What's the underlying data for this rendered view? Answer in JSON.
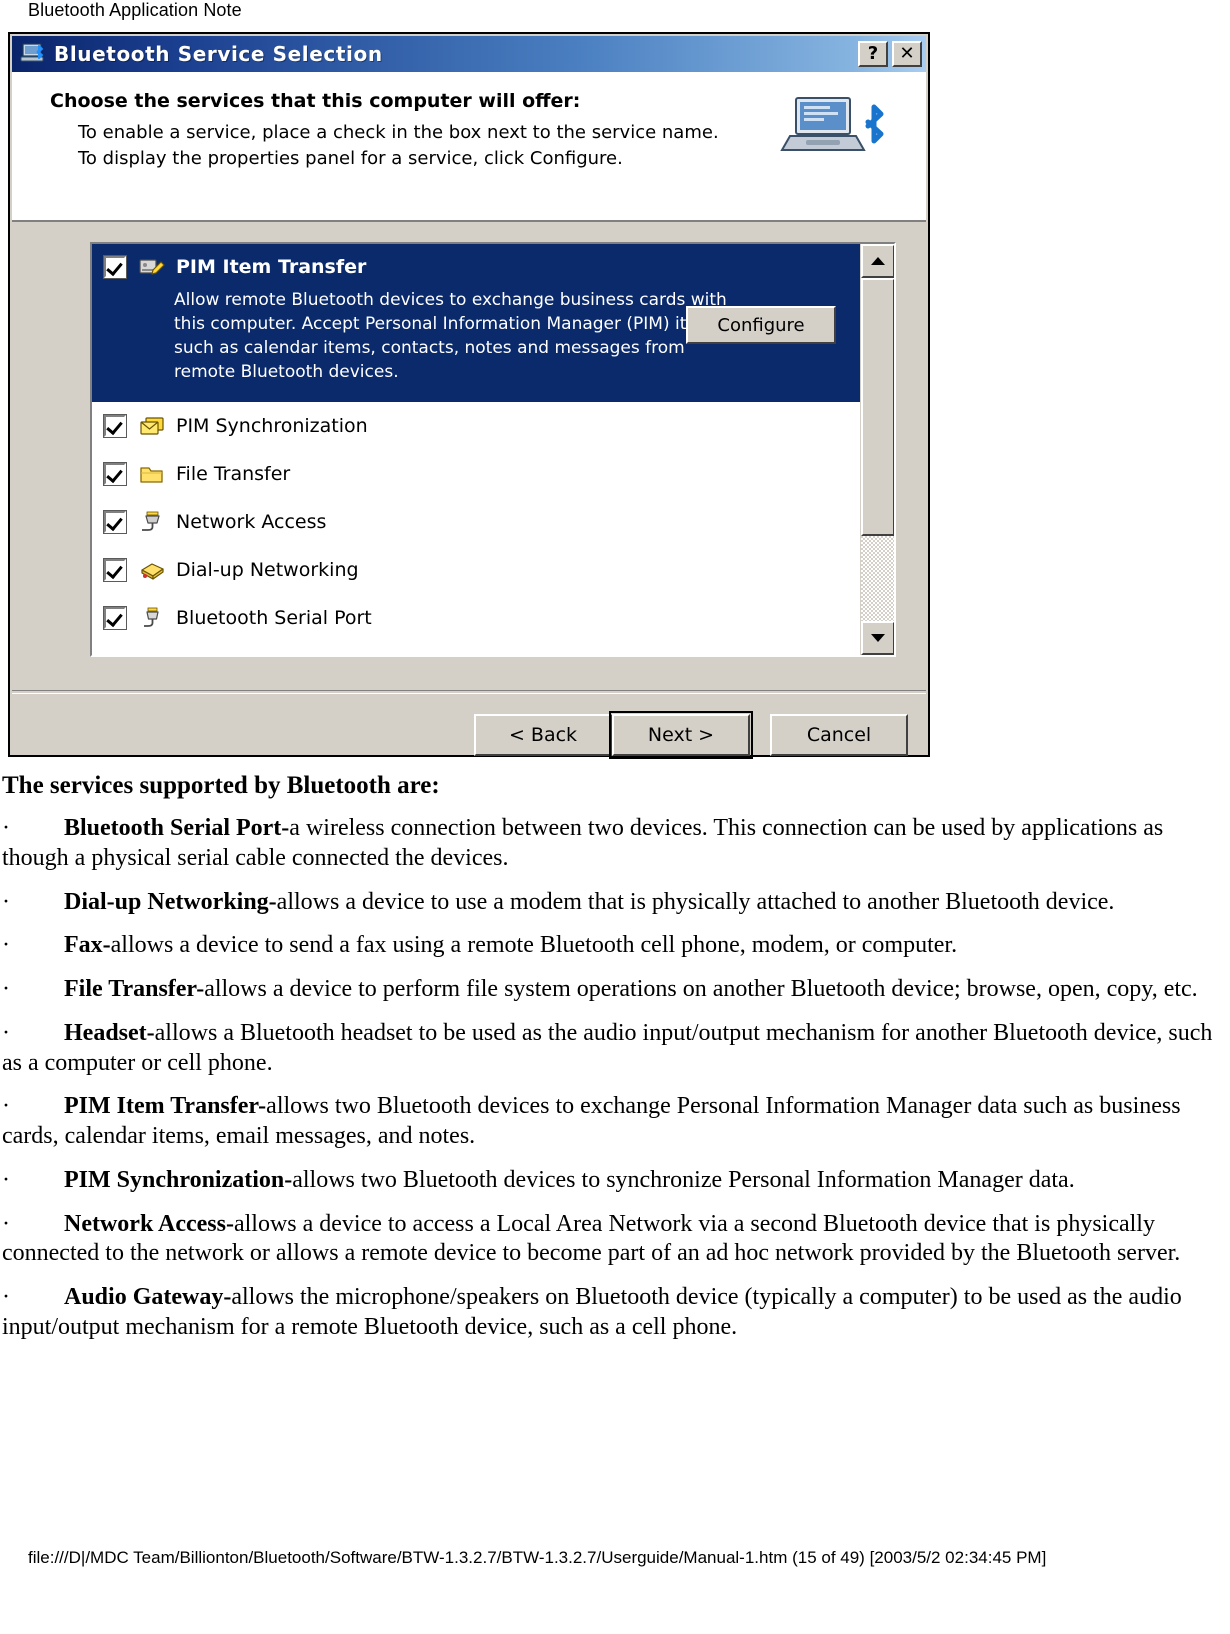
{
  "page": {
    "header_label": "Bluetooth Application Note",
    "footer_path": "file:///D|/MDC Team/Billionton/Bluetooth/Software/BTW-1.3.2.7/BTW-1.3.2.7/Userguide/Manual-1.htm (15 of 49) [2003/5/2 02:34:45 PM]"
  },
  "dialog": {
    "title": "Bluetooth Service Selection",
    "titlebar_icon": "computer-bluetooth-icon",
    "help_button_label": "?",
    "close_button_label": "✕",
    "header": {
      "heading": "Choose the services that this computer will offer:",
      "line1": "To enable a service, place a check in the box next to the service name.",
      "line2": "To display the properties panel for a service, click Configure.",
      "illustration": "laptop-bluetooth-illustration"
    },
    "selected_service": {
      "label": "PIM Item Transfer",
      "icon": "pim-item-transfer-icon",
      "checked": true,
      "description": "Allow remote Bluetooth devices to exchange business cards with this computer. Accept Personal Information Manager (PIM) items such as calendar items, contacts, notes and messages from remote Bluetooth devices.",
      "configure_label": "Configure"
    },
    "services": [
      {
        "label": "PIM Synchronization",
        "icon": "mail-sync-icon",
        "checked": true
      },
      {
        "label": "File Transfer",
        "icon": "folder-icon",
        "checked": true
      },
      {
        "label": "Network Access",
        "icon": "network-plug-icon",
        "checked": true
      },
      {
        "label": "Dial-up Networking",
        "icon": "modem-icon",
        "checked": true
      },
      {
        "label": "Bluetooth Serial Port",
        "icon": "serial-port-icon",
        "checked": true
      }
    ],
    "scrollbar": {
      "up_arrow": "scroll-up-arrow",
      "down_arrow": "scroll-down-arrow"
    },
    "buttons": {
      "back": "< Back",
      "next": "Next >",
      "cancel": "Cancel"
    },
    "colors": {
      "titlebar_start": "#0a246a",
      "titlebar_end": "#a9cdf0",
      "face": "#d4d0c8",
      "selection": "#0a2a6b"
    }
  },
  "document": {
    "heading": "The services supported by Bluetooth are:",
    "bullet_char": "·",
    "items": [
      {
        "term": "Bluetooth Serial Port-",
        "text": "a wireless connection between two devices. This connection can be used by applications as though a physical serial cable connected the devices."
      },
      {
        "term": "Dial-up Networking-",
        "text": "allows a device to use a modem that is physically attached to another Bluetooth device."
      },
      {
        "term": "Fax-",
        "text": "allows a device to send a fax using a remote Bluetooth cell phone, modem, or computer."
      },
      {
        "term": "File Transfer-",
        "text": "allows a device to perform file system operations on another Bluetooth device; browse, open, copy, etc."
      },
      {
        "term": "Headset-",
        "text": "allows a Bluetooth headset to be used as the audio input/output mechanism for another Bluetooth device, such as a computer or cell phone."
      },
      {
        "term": "PIM Item Transfer-",
        "text": "allows two Bluetooth devices to exchange Personal Information Manager data such as business cards, calendar items, email messages, and notes."
      },
      {
        "term": "PIM Synchronization-",
        "text": "allows two Bluetooth devices to synchronize Personal Information Manager data."
      },
      {
        "term": "Network Access-",
        "text": "allows a device to access a Local Area Network via a second Bluetooth device that is physically connected to the network or allows a remote device to become part of an ad hoc network provided by the Bluetooth server."
      },
      {
        "term": "Audio Gateway-",
        "text": "allows the microphone/speakers on Bluetooth device (typically a computer) to be used as the audio input/output mechanism for a remote Bluetooth device, such as a cell phone."
      }
    ]
  }
}
